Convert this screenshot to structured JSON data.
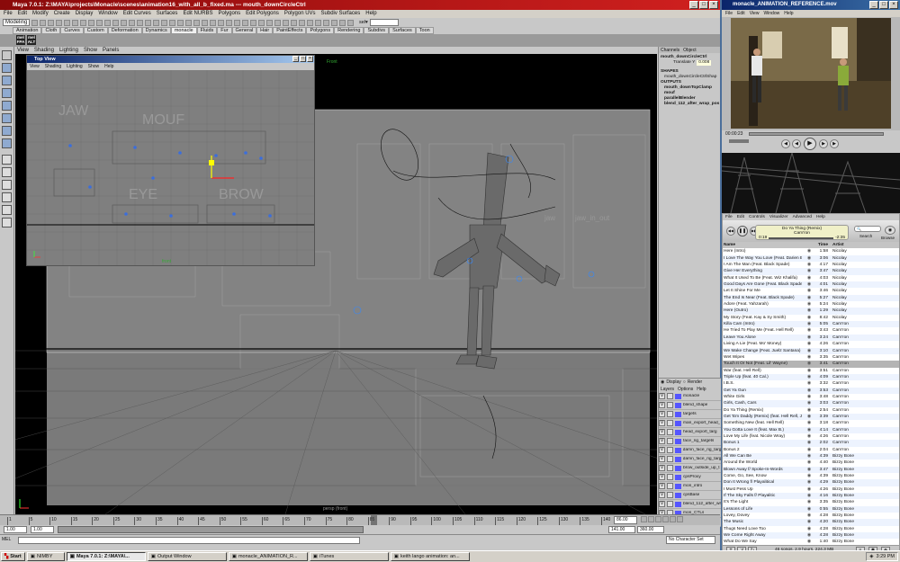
{
  "maya": {
    "title": "Maya 7.0.1: Z:\\MAYA\\projects\\Monacle\\scenes\\animation16_with_all_b_fixed.ma   ---   mouth_downCircleCtrl",
    "menus": [
      "File",
      "Edit",
      "Modify",
      "Create",
      "Display",
      "Window",
      "Edit Curves",
      "Surfaces",
      "Edit NURBS",
      "Polygons",
      "Edit Polygons",
      "Polygon UVs",
      "Subdiv Surfaces",
      "Help"
    ],
    "mode": "Modeling",
    "sel_label": "sel▾",
    "shelf_tabs": [
      "Animation",
      "Cloth",
      "Curves",
      "Custom",
      "Deformation",
      "Dynamics",
      "monacle",
      "Fluids",
      "Fur",
      "General",
      "Hair",
      "PaintEffects",
      "Polygons",
      "Rendering",
      "Subdivs",
      "Surfaces",
      "Toon"
    ],
    "shelf_icons": [
      "mel",
      "mel"
    ],
    "shelf_icon_sub": [
      "FPA",
      "ALT"
    ],
    "panel_menus": [
      "View",
      "Shading",
      "Lighting",
      "Show",
      "Panels"
    ],
    "viewport_label": "Front",
    "persp_label": "persp (front)"
  },
  "top_view": {
    "title": "Top View",
    "menus": [
      "View",
      "Shading",
      "Lighting",
      "Show",
      "Help"
    ],
    "labels": [
      "JAW",
      "MOUF",
      "EYE",
      "BROW"
    ],
    "label": "front"
  },
  "channel_box": {
    "tabs": [
      "Channels",
      "Object"
    ],
    "object": "mouth_downCircleCtrl",
    "attr_label": "Translate Y",
    "attr_value": "0.008",
    "shapes_header": "SHAPES",
    "shape": "mouth_downCircleCtrlShap",
    "outputs_header": "OUTPUTS",
    "outputs": [
      "mouth_downTopClamp",
      "mouf",
      "parallelBlender",
      "blend_112_after_wrap_pos"
    ]
  },
  "layers": {
    "display_label": "Display",
    "render_label": "Render",
    "menus": [
      "Layers",
      "Options",
      "Help"
    ],
    "items": [
      "monacle",
      "blend_shape",
      "targets",
      "man_export_head_",
      "head_export_targ",
      "face_rig_targets",
      "damn_face_rig_targ",
      "damn_face_rig_targ",
      "brow_outside_up_t",
      "cpsProxy",
      "mon_intro",
      "cpsBase",
      "blend_112_after_wr",
      "mon_CTLs",
      "fullGeo_layer"
    ]
  },
  "timeline": {
    "ticks": [
      "1",
      "5",
      "10",
      "15",
      "20",
      "25",
      "30",
      "35",
      "40",
      "45",
      "50",
      "55",
      "60",
      "65",
      "70",
      "75",
      "80",
      "85",
      "90",
      "95",
      "100",
      "105",
      "110",
      "115",
      "120",
      "125",
      "130",
      "135",
      "140"
    ],
    "current": "86.00",
    "range_start": "1.00",
    "range_end": "141.00",
    "anim_start": "1.00",
    "anim_end": "360.00",
    "char_set": "No Character Set",
    "cmd_label": "MEL"
  },
  "quicktime": {
    "title": "monacle_ANIMATION_REFERENCE.mov",
    "menus": [
      "File",
      "Edit",
      "View",
      "Window",
      "Help"
    ],
    "time": "00:00:23"
  },
  "itunes": {
    "menus": [
      "File",
      "Edit",
      "Controls",
      "Visualizer",
      "Advanced",
      "Help"
    ],
    "now_playing": "Do Ya Thing (Remix)",
    "now_artist": "Cam'ron",
    "elapsed": "0:19",
    "remaining": "-2:35",
    "search_label": "Search",
    "browse_label": "Browse",
    "col_name": "Name",
    "col_time": "Time",
    "col_artist": "Artist",
    "status": "46 songs, 2.9 hours, 224.3 MB",
    "tracks": [
      [
        "Here (Intro)",
        "1:58",
        "Nicolay"
      ],
      [
        "I Love The Way You Love (Feat. Darien Br...",
        "3:06",
        "Nicolay"
      ],
      [
        "I Am The Man (Feat. Black Spade)",
        "4:17",
        "Nicolay"
      ],
      [
        "Give Her Everything",
        "3:47",
        "Nicolay"
      ],
      [
        "What It Used To Be (Feat. Wiz Khalifa)",
        "4:03",
        "Nicolay"
      ],
      [
        "Good Days Are Gone (Feat. Black Spade)",
        "4:01",
        "Nicolay"
      ],
      [
        "Let It Shine For Me",
        "3:46",
        "Nicolay"
      ],
      [
        "The End Is Near (Feat. Black Spade)",
        "5:27",
        "Nicolay"
      ],
      [
        "Adore (Feat. Yahzarah)",
        "5:24",
        "Nicolay"
      ],
      [
        "Here (Outro)",
        "1:29",
        "Nicolay"
      ],
      [
        "My Story (Feat. Kay & Sy Smith)",
        "8:42",
        "Nicolay"
      ],
      [
        "Killa Cam (Intro)",
        "5:05",
        "Cam'ron"
      ],
      [
        "He Tried To Play Me (Feat. Hell Rell)",
        "3:43",
        "Cam'ron"
      ],
      [
        "Leave You Alone",
        "3:24",
        "Cam'ron"
      ],
      [
        "Living A Lie (Feat. Mo' Money)",
        "4:26",
        "Cam'ron"
      ],
      [
        "We Make Change (Feat. Juelz Santana)",
        "3:10",
        "Cam'ron"
      ],
      [
        "Wet Wipes",
        "3:35",
        "Cam'ron"
      ],
      [
        "Touch It Or Not (Feat. Lil' Wayne)",
        "3:41",
        "Cam'ron"
      ],
      [
        "War (feat. Hell Rell)",
        "3:51",
        "Cam'ron"
      ],
      [
        "Triple Up (feat. 40 Cal.)",
        "4:09",
        "Cam'ron"
      ],
      [
        "I.B.S.",
        "3:32",
        "Cam'ron"
      ],
      [
        "Get Ya Gun",
        "3:53",
        "Cam'ron"
      ],
      [
        "White Girls",
        "3:48",
        "Cam'ron"
      ],
      [
        "Girls, Cash, Cars",
        "3:03",
        "Cam'ron"
      ],
      [
        "Do Ya Thing (Remix)",
        "2:54",
        "Cam'ron"
      ],
      [
        "Get 'Em Daddy (Remix) (feat. Hell Rell, Ji...",
        "3:39",
        "Cam'ron"
      ],
      [
        "Something New (feat. Hell Rell)",
        "3:18",
        "Cam'ron"
      ],
      [
        "You Gotta Love It (feat. Max B.)",
        "4:14",
        "Cam'ron"
      ],
      [
        "Love My Life (feat. Nicole Wray)",
        "4:26",
        "Cam'ron"
      ],
      [
        "Bonus 1",
        "2:02",
        "Cam'ron"
      ],
      [
        "Bonus 2",
        "2:04",
        "Cam'ron"
      ],
      [
        "All We Can Be",
        "4:39",
        "Bizzy Bone"
      ],
      [
        "Around the World",
        "4:40",
        "Bizzy Bone"
      ],
      [
        "Blown Away f/ Spoke-In-Words",
        "3:47",
        "Bizzy Bone"
      ],
      [
        "Come, Go, See, Know",
        "4:39",
        "Bizzy Bone"
      ],
      [
        "Don It Wrong f/ Playalitical",
        "4:29",
        "Bizzy Bone"
      ],
      [
        "I Must Pess Up",
        "4:26",
        "Bizzy Bone"
      ],
      [
        "If The Sky Falls f/ Playalitic",
        "4:16",
        "Bizzy Bone"
      ],
      [
        "It's The Light",
        "3:35",
        "Bizzy Bone"
      ],
      [
        "Lessons of Life",
        "0:55",
        "Bizzy Bone"
      ],
      [
        "Lovey, Dovey",
        "4:28",
        "Bizzy Bone"
      ],
      [
        "The Music",
        "4:20",
        "Bizzy Bone"
      ],
      [
        "Thugs Need Love Too",
        "4:28",
        "Bizzy Bone"
      ],
      [
        "We Come Right Away",
        "4:28",
        "Bizzy Bone"
      ],
      [
        "What Do We Say",
        "1:40",
        "Bizzy Bone"
      ],
      [
        "Wit A 20 Bella Bill f/ Young D",
        "4:49",
        "Bizzy Bone"
      ]
    ],
    "selected_index": 17
  },
  "taskbar": {
    "start": "Start",
    "tasks": [
      "NIMBY",
      "Maya 7.0.1: Z:\\MAYA\\...",
      "Output Window",
      "monacle_ANIMATION_R...",
      "iTunes",
      "keith lango animation: an..."
    ],
    "active_index": 1,
    "clock": "3:29 PM"
  }
}
